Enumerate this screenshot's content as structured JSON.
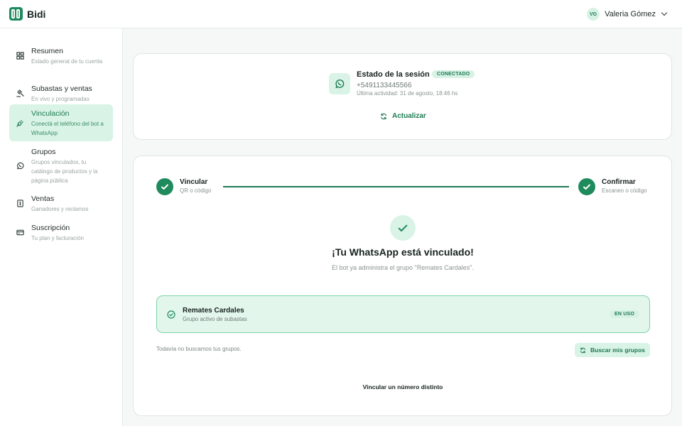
{
  "app": {
    "name": "Bidi"
  },
  "user": {
    "initials": "VG",
    "name": "Valeria Gómez"
  },
  "sidebar": {
    "items": [
      {
        "title": "Resumen",
        "subtitle": "Estado general de tu cuenta",
        "icon": "dashboard-icon",
        "active": false
      },
      {
        "title": "Subastas y ventas",
        "subtitle": "En vivo y programadas",
        "icon": "gavel-icon",
        "active": false
      },
      {
        "title": "Vinculación",
        "subtitle": "Conectá el teléfono del bot a WhatsApp",
        "icon": "plug-icon",
        "active": true
      },
      {
        "title": "Grupos",
        "subtitle": "Grupos vinculados, tu catálogo de productos y la página pública",
        "icon": "whatsapp-icon",
        "active": false
      },
      {
        "title": "Ventas",
        "subtitle": "Ganadores y reclamos",
        "icon": "receipt-icon",
        "active": false
      },
      {
        "title": "Suscripción",
        "subtitle": "Tu plan y facturación",
        "icon": "credit-card-icon",
        "active": false
      }
    ]
  },
  "session": {
    "title": "Estado de la sesión",
    "status": "CONECTADO",
    "phone": "+5491133445566",
    "last_activity": "Última actividad: 31 de agosto, 18:46 hs",
    "refresh_label": "Actualizar"
  },
  "link": {
    "steps": [
      {
        "title": "Vincular",
        "subtitle": "QR o código"
      },
      {
        "title": "Confirmar",
        "subtitle": "Escaneo o código"
      }
    ],
    "headline": "¡Tu WhatsApp está vinculado!",
    "subline": "El bot ya administra el grupo \"Remates Cardales\".",
    "group": {
      "name": "Remates Cardales",
      "subtitle": "Grupo activo de subastas",
      "badge": "EN USO"
    },
    "footnote": "Todavía no buscamos tus grupos.",
    "search_label": "Buscar mis grupos",
    "other_number_label": "Vincular un número distinto"
  },
  "colors": {
    "accent": "#1f8a5c",
    "accent_light": "#d9f3e6",
    "accent_text": "#1f7a53"
  }
}
